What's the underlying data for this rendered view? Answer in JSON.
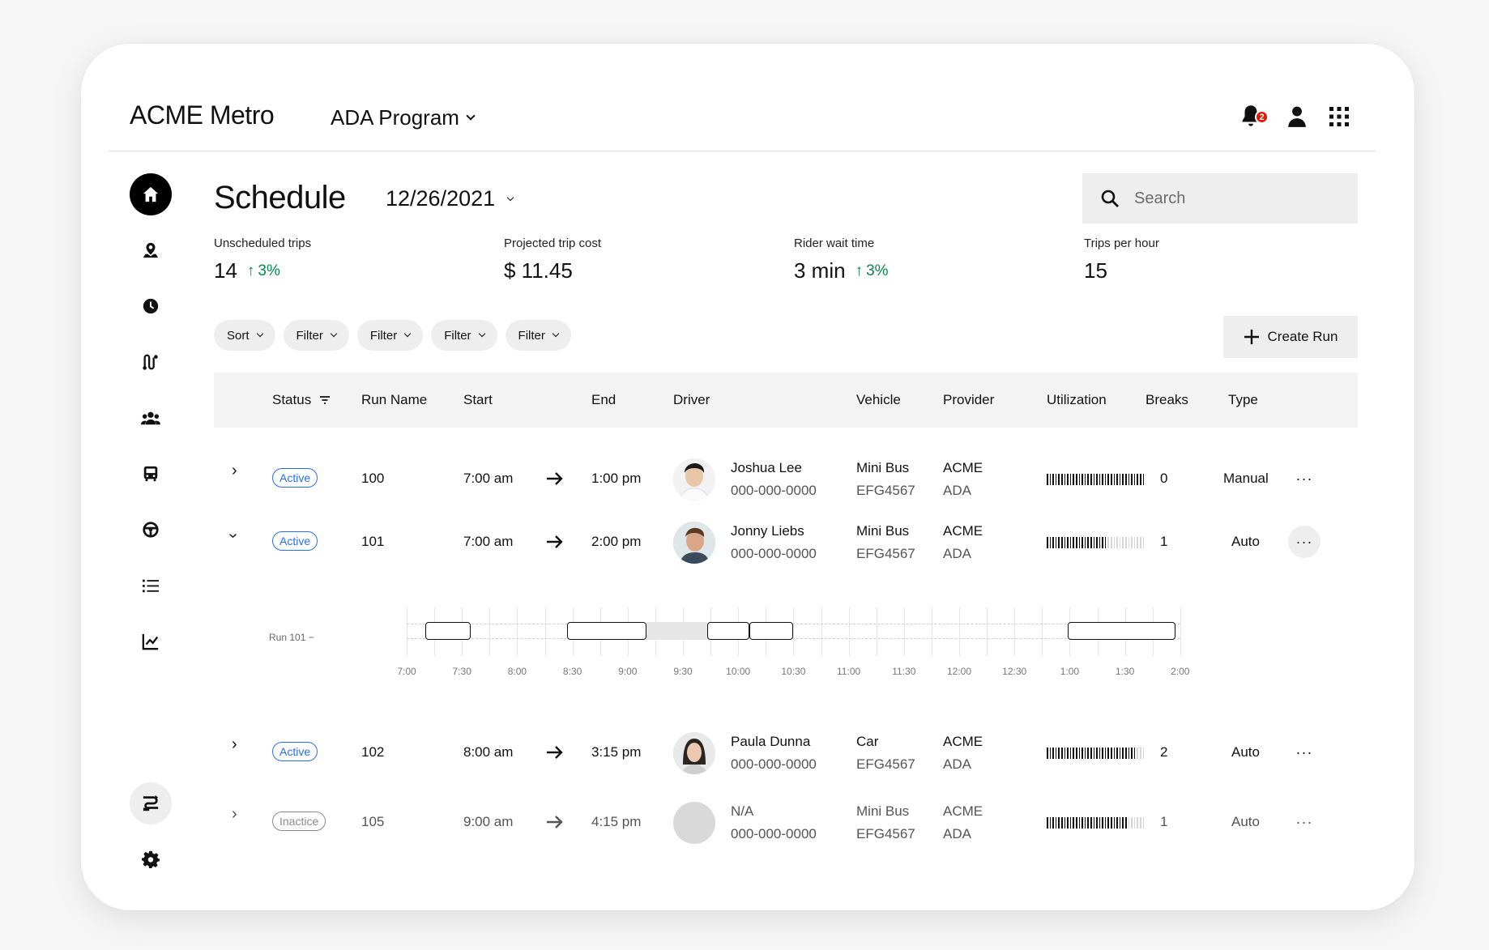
{
  "app": {
    "brand": "ACME Metro",
    "program": "ADA Program",
    "notification_count": "2"
  },
  "header": {
    "title": "Schedule",
    "date": "12/26/2021",
    "search_placeholder": "Search"
  },
  "stats": [
    {
      "label": "Unscheduled trips",
      "value": "14",
      "delta": "3%"
    },
    {
      "label": "Projected trip cost",
      "value": "$ 11.45",
      "delta": ""
    },
    {
      "label": "Rider wait time",
      "value": "3 min",
      "delta": "3%"
    },
    {
      "label": "Trips per hour",
      "value": "15",
      "delta": ""
    }
  ],
  "filters": [
    "Sort",
    "Filter",
    "Filter",
    "Filter",
    "Filter"
  ],
  "create_run_label": "Create Run",
  "columns": [
    "Status",
    "Run Name",
    "Start",
    "End",
    "Driver",
    "Vehicle",
    "Provider",
    "Utilization",
    "Breaks",
    "Type"
  ],
  "rows": [
    {
      "status": "Active",
      "run": "100",
      "start": "7:00 am",
      "end": "1:00 pm",
      "driver": "Joshua Lee",
      "phone": "000-000-0000",
      "vehicle": "Mini Bus",
      "plate": "EFG4567",
      "provider": "ACME",
      "provider_sub": "ADA",
      "utilization": 1.0,
      "breaks": "0",
      "type": "Manual"
    },
    {
      "status": "Active",
      "run": "101",
      "start": "7:00 am",
      "end": "2:00 pm",
      "driver": "Jonny Liebs",
      "phone": "000-000-0000",
      "vehicle": "Mini Bus",
      "plate": "EFG4567",
      "provider": "ACME",
      "provider_sub": "ADA",
      "utilization": 0.62,
      "breaks": "1",
      "type": "Auto"
    },
    {
      "status": "Active",
      "run": "102",
      "start": "8:00 am",
      "end": "3:15 pm",
      "driver": "Paula Dunna",
      "phone": "000-000-0000",
      "vehicle": "Car",
      "plate": "EFG4567",
      "provider": "ACME",
      "provider_sub": "ADA",
      "utilization": 0.92,
      "breaks": "2",
      "type": "Auto"
    },
    {
      "status": "Inactice",
      "run": "105",
      "start": "9:00 am",
      "end": "4:15 pm",
      "driver": "N/A",
      "phone": "000-000-0000",
      "vehicle": "Mini Bus",
      "plate": "EFG4567",
      "provider": "ACME",
      "provider_sub": "ADA",
      "utilization": 0.82,
      "breaks": "1",
      "type": "Auto"
    }
  ],
  "timeline": {
    "run_label": "Run 101",
    "ticks": [
      "7:00",
      "7:30",
      "8:00",
      "8:30",
      "9:00",
      "9:30",
      "10:00",
      "10:30",
      "11:00",
      "11:30",
      "12:00",
      "12:30",
      "1:00",
      "1:30",
      "2:00"
    ],
    "segments": [
      {
        "start": 0.17,
        "end": 0.58,
        "kind": "trip"
      },
      {
        "start": 1.45,
        "end": 2.17,
        "kind": "trip"
      },
      {
        "start": 2.17,
        "end": 2.72,
        "kind": "break"
      },
      {
        "start": 2.72,
        "end": 3.1,
        "kind": "trip"
      },
      {
        "start": 3.1,
        "end": 3.5,
        "kind": "trip"
      },
      {
        "start": 5.98,
        "end": 6.96,
        "kind": "trip"
      }
    ]
  },
  "colors": {
    "accent": "#276ef1",
    "positive": "#048848",
    "badge": "#e11900"
  }
}
